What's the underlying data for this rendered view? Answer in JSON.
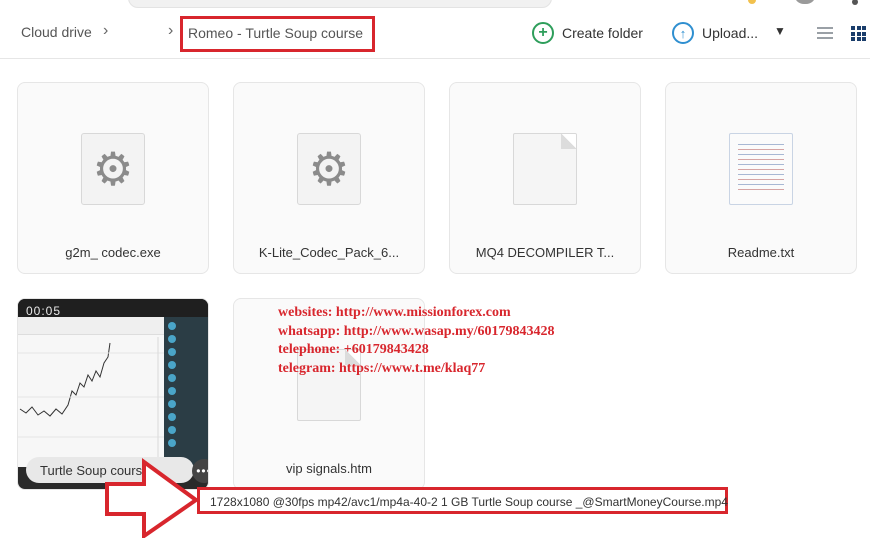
{
  "breadcrumb": {
    "root": "Cloud drive",
    "current": "Romeo - Turtle Soup course"
  },
  "toolbar": {
    "create_folder": "Create folder",
    "upload": "Upload..."
  },
  "files": [
    {
      "name": "g2m_ codec.exe",
      "icon": "gear-icon"
    },
    {
      "name": "K-Lite_Codec_Pack_6...",
      "icon": "gear-icon"
    },
    {
      "name": "MQ4 DECOMPILER T...",
      "icon": "blank-document-icon"
    },
    {
      "name": "Readme.txt",
      "icon": "text-document-icon"
    },
    {
      "name": "Turtle Soup course ...",
      "icon": "video-thumbnail",
      "duration": "00:05"
    },
    {
      "name": "vip signals.htm",
      "icon": "blank-document-icon"
    }
  ],
  "overlay_info": {
    "line1": "websites: http://www.missionforex.com",
    "line2": "whatsapp: http://www.wasap.my/60179843428",
    "line3": "telephone: +60179843428",
    "line4": "telegram: https://www.t.me/klaq77"
  },
  "file_details": "1728x1080 @30fps mp42/avc1/mp4a-40-2 1 GB Turtle Soup course _@SmartMoneyCourse.mp4",
  "colors": {
    "annotation_red": "#d8262d",
    "create_green": "#2e9e5b",
    "upload_blue": "#2f8fd0"
  }
}
